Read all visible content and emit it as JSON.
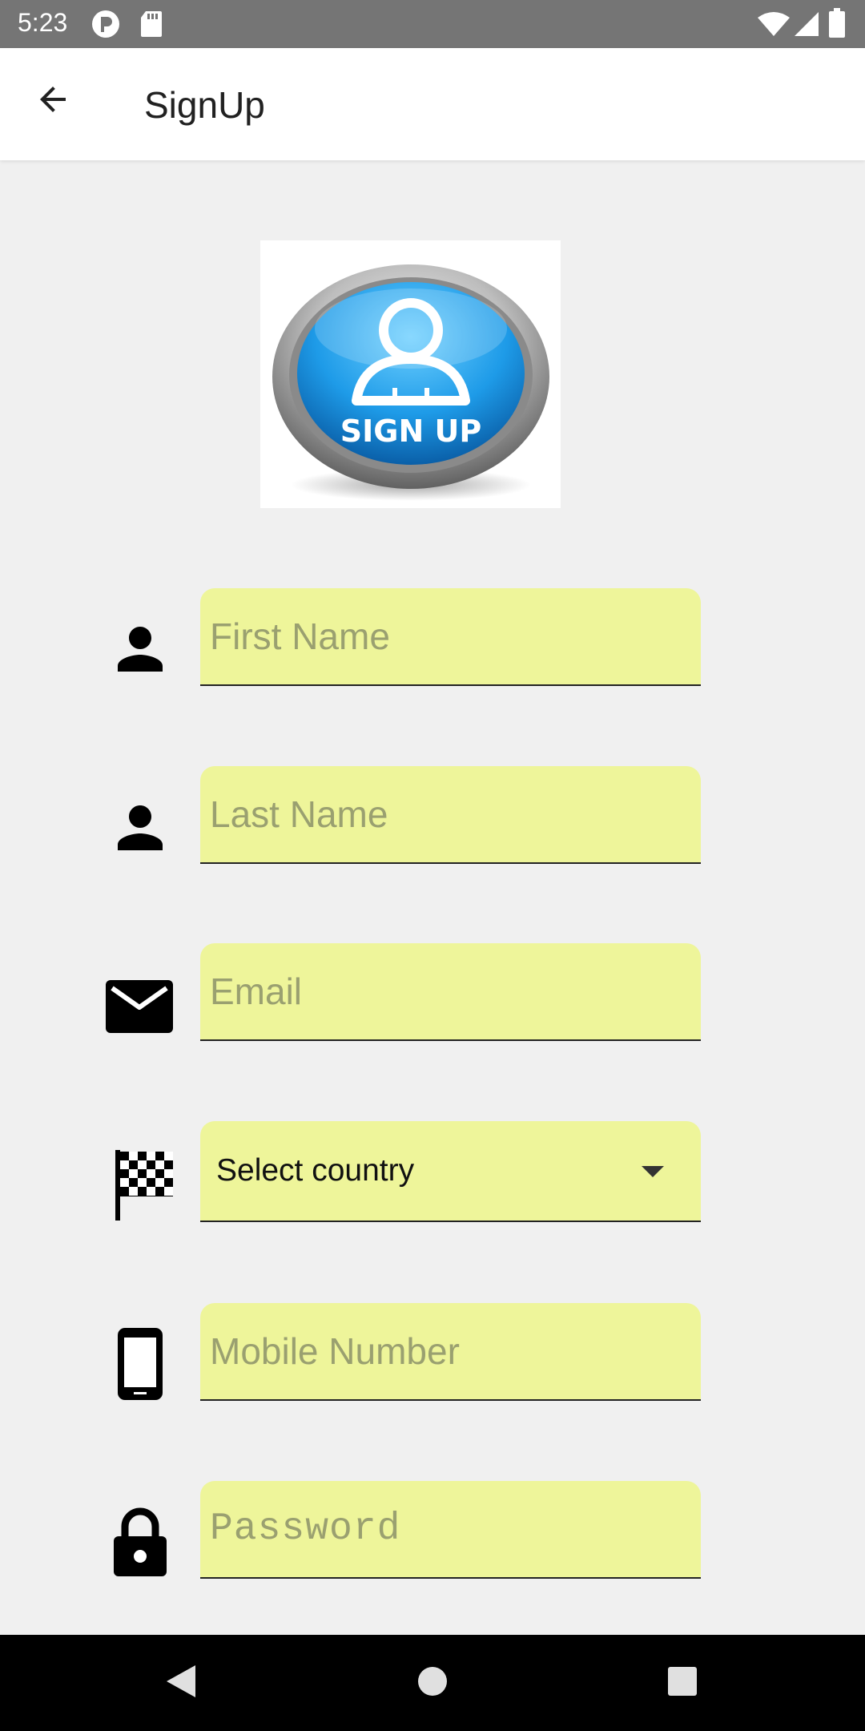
{
  "status_bar": {
    "time": "5:23",
    "icons": [
      "sim-icon",
      "sd-card-icon",
      "wifi-icon",
      "signal-icon",
      "battery-icon"
    ]
  },
  "app_bar": {
    "title": "SignUp",
    "back_icon": "arrow-left-icon"
  },
  "logo": {
    "text": "SIGN UP",
    "colors": {
      "blue": "#1e9be8",
      "ring": "#9e9e9e"
    }
  },
  "form": {
    "first_name": {
      "placeholder": "First Name",
      "value": "",
      "icon": "person-icon"
    },
    "last_name": {
      "placeholder": "Last Name",
      "value": "",
      "icon": "person-icon"
    },
    "email": {
      "placeholder": "Email",
      "value": "",
      "icon": "mail-icon"
    },
    "country": {
      "selected": "Select country",
      "icon": "flag-icon"
    },
    "mobile": {
      "placeholder": "Mobile Number",
      "value": "",
      "icon": "phone-icon"
    },
    "password": {
      "placeholder": "Password",
      "value": "",
      "icon": "lock-icon"
    }
  },
  "colors": {
    "field_bg": "#eef59a",
    "page_bg": "#f0f0f0",
    "status_bar": "#757575"
  },
  "nav_bar": {
    "buttons": [
      "back-triangle-icon",
      "home-circle-icon",
      "recents-square-icon"
    ]
  }
}
